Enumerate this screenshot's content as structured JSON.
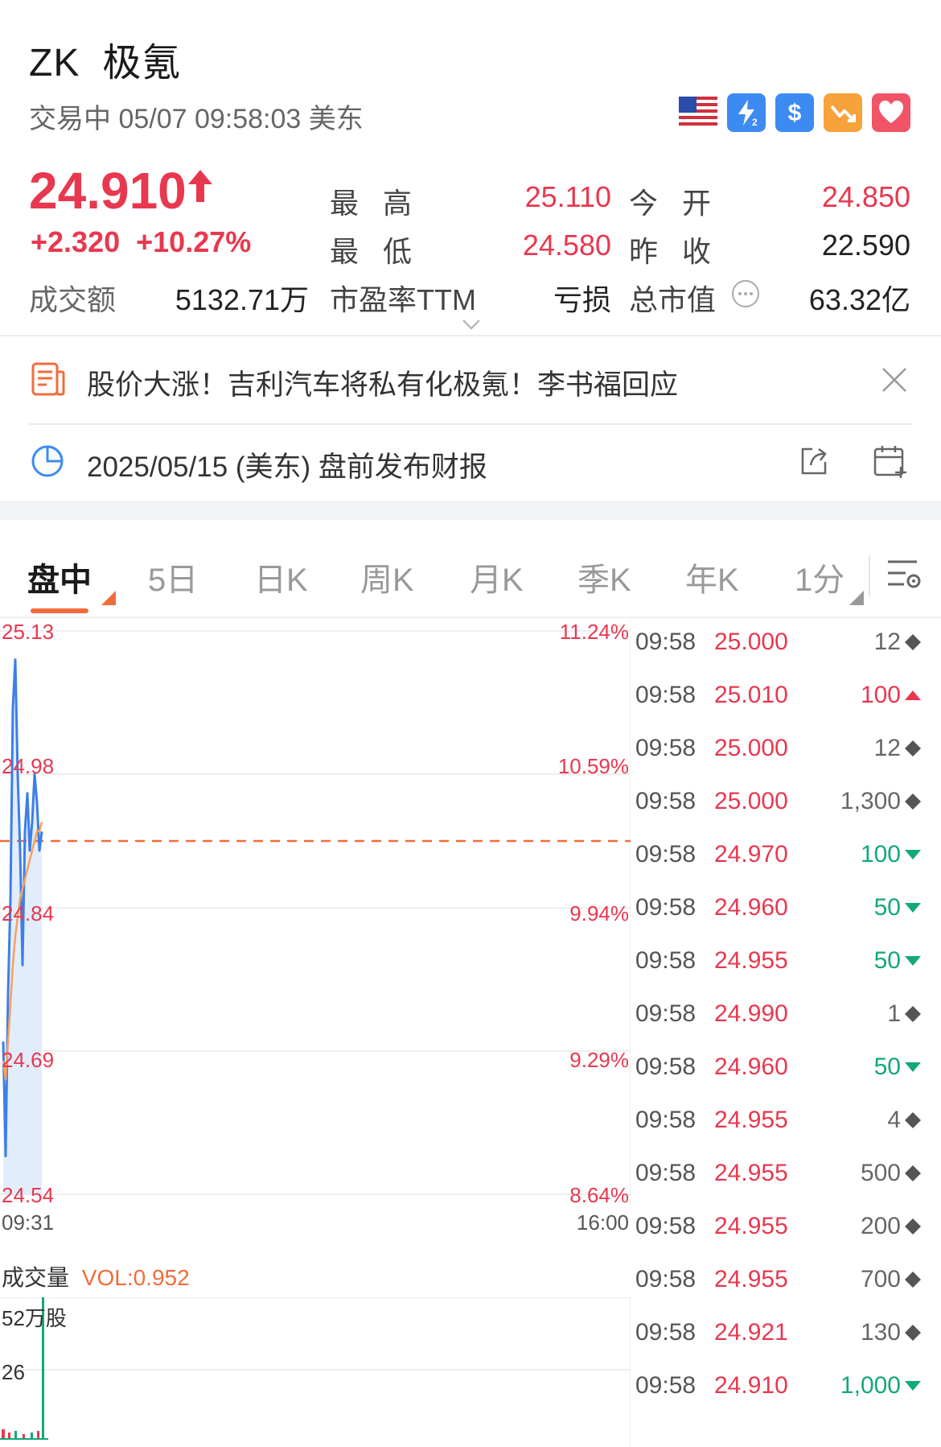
{
  "header": {
    "symbol": "ZK",
    "name": "极氪",
    "status": "交易中 05/07 09:58:03 美东"
  },
  "quote": {
    "price": "24.910",
    "change": "+2.320",
    "change_pct": "+10.27%",
    "labels": {
      "high": "最高",
      "low": "最低",
      "open": "今开",
      "prev_close": "昨收",
      "turnover": "成交额",
      "pe": "市盈率TTM",
      "mktcap": "总市值"
    },
    "high": "25.110",
    "low": "24.580",
    "open": "24.850",
    "prev_close": "22.590",
    "turnover": "5132.71万",
    "pe": "亏损",
    "mktcap": "63.32亿"
  },
  "news": {
    "headline": "股价大涨！吉利汽车将私有化极氪！李书福回应",
    "earnings": "2025/05/15 (美东) 盘前发布财报"
  },
  "tabs": [
    "盘中",
    "5日",
    "日K",
    "周K",
    "月K",
    "季K",
    "年K",
    "1分"
  ],
  "chart_data": {
    "type": "line",
    "y_axis_left": [
      "25.13",
      "24.98",
      "24.84",
      "24.69",
      "24.54"
    ],
    "y_axis_right": [
      "11.24%",
      "10.59%",
      "9.94%",
      "9.29%",
      "8.64%"
    ],
    "ylim": [
      24.54,
      25.13
    ],
    "x_start": "09:31",
    "x_end": "16:00",
    "reference_line": 24.91,
    "series": [
      {
        "values": [
          24.7,
          24.58,
          24.75,
          24.85,
          25.05,
          25.1,
          24.98,
          24.9,
          24.78,
          24.92,
          24.96,
          24.9,
          24.93,
          24.98,
          24.95,
          24.9,
          24.92
        ]
      },
      {
        "values": [
          24.68,
          24.66,
          24.7,
          24.74,
          24.78,
          24.81,
          24.83,
          24.85,
          24.86,
          24.87,
          24.88,
          24.89,
          24.9,
          24.91,
          24.92,
          24.92,
          24.93
        ]
      }
    ]
  },
  "volume": {
    "label": "成交量",
    "vol": "VOL:0.952",
    "top": "52万股",
    "mid": "26"
  },
  "trades": [
    {
      "time": "09:58",
      "price": "25.000",
      "volume": "12",
      "dir": "neutral"
    },
    {
      "time": "09:58",
      "price": "25.010",
      "volume": "100",
      "dir": "up"
    },
    {
      "time": "09:58",
      "price": "25.000",
      "volume": "12",
      "dir": "neutral"
    },
    {
      "time": "09:58",
      "price": "25.000",
      "volume": "1,300",
      "dir": "neutral"
    },
    {
      "time": "09:58",
      "price": "24.970",
      "volume": "100",
      "dir": "down"
    },
    {
      "time": "09:58",
      "price": "24.960",
      "volume": "50",
      "dir": "down"
    },
    {
      "time": "09:58",
      "price": "24.955",
      "volume": "50",
      "dir": "down"
    },
    {
      "time": "09:58",
      "price": "24.990",
      "volume": "1",
      "dir": "neutral"
    },
    {
      "time": "09:58",
      "price": "24.960",
      "volume": "50",
      "dir": "down"
    },
    {
      "time": "09:58",
      "price": "24.955",
      "volume": "4",
      "dir": "neutral"
    },
    {
      "time": "09:58",
      "price": "24.955",
      "volume": "500",
      "dir": "neutral"
    },
    {
      "time": "09:58",
      "price": "24.955",
      "volume": "200",
      "dir": "neutral"
    },
    {
      "time": "09:58",
      "price": "24.955",
      "volume": "700",
      "dir": "neutral"
    },
    {
      "time": "09:58",
      "price": "24.921",
      "volume": "130",
      "dir": "neutral"
    },
    {
      "time": "09:58",
      "price": "24.910",
      "volume": "1,000",
      "dir": "down"
    }
  ]
}
